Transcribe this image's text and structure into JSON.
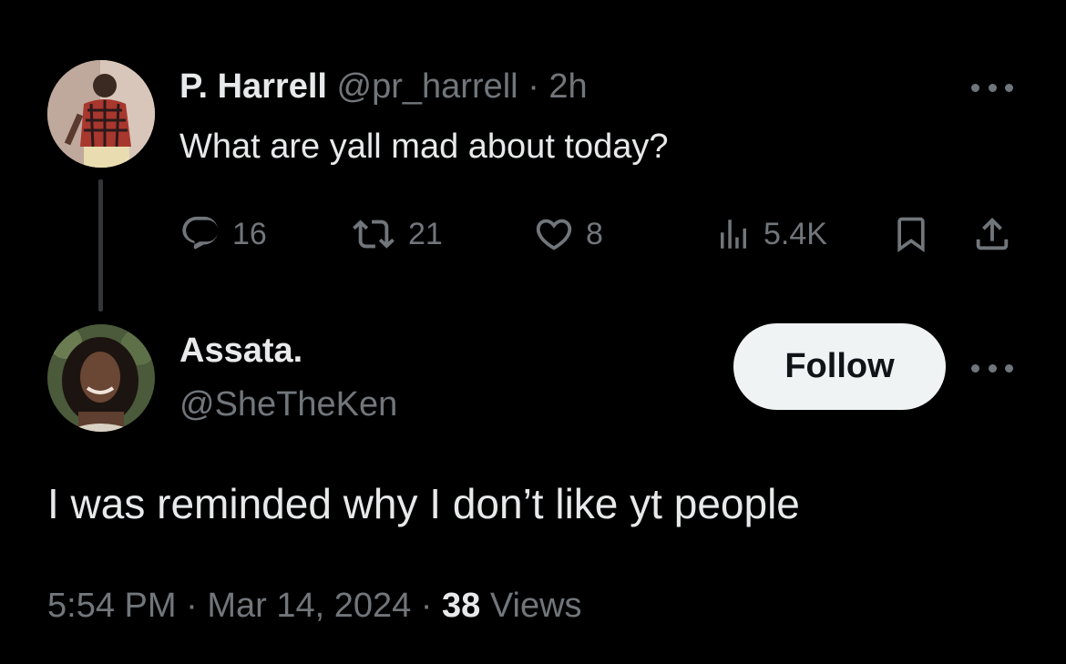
{
  "parent_tweet": {
    "display_name": "P. Harrell",
    "handle": "@pr_harrell",
    "separator": "·",
    "time_ago": "2h",
    "text": "What are yall mad about today?",
    "more_icon": "more-horizontal-icon",
    "actions": {
      "replies": "16",
      "reposts": "21",
      "likes": "8",
      "views": "5.4K"
    }
  },
  "reply_tweet": {
    "display_name": "Assata.",
    "handle": "@SheTheKen",
    "follow_label": "Follow",
    "more_icon": "more-horizontal-icon",
    "text": "I was reminded why I don’t like yt people",
    "time": "5:54 PM",
    "separator": "·",
    "date": "Mar 14, 2024",
    "views_count": "38",
    "views_label": "Views"
  },
  "colors": {
    "background": "#000000",
    "primary_text": "#e7e9ea",
    "secondary_text": "#71767b",
    "follow_button_bg": "#eff3f4",
    "thread_line": "#333639"
  }
}
